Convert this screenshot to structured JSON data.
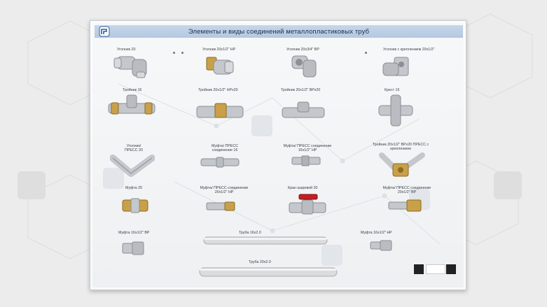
{
  "board": {
    "title": "Элементы и виды соединений металлопластиковых труб"
  },
  "fittings": [
    {
      "label": "Уголник 20"
    },
    {
      "label": "Уголник 20х1/2\" НР"
    },
    {
      "label": "Уголник 20х3/4\" ВР"
    },
    {
      "label": "Уголник с креплением 20х1/2\""
    },
    {
      "label": "Тройник 16"
    },
    {
      "label": "Тройник 20х1/2\" НРх20"
    },
    {
      "label": "Тройник 20х1/2\" ВРх20"
    },
    {
      "label": "Крест 16"
    },
    {
      "label": "Уголник/ ПРЕСС 20"
    },
    {
      "label": "Муфта/ ПРЕСС соединение 16"
    },
    {
      "label": "Муфта/ ПРЕСС соединение 16х1/2\" НР"
    },
    {
      "label": "Тройник 20х1/2\" ВРх20 ПРЕСС с креплением"
    },
    {
      "label": "Муфта 20"
    },
    {
      "label": "Муфта/ ПРЕСС соединение 20х1/2\" НР"
    },
    {
      "label": "Кран шаровой 20"
    },
    {
      "label": "Муфта/ ПРЕСС соединение 20х1/2\" ВР"
    },
    {
      "label": "Муфта 16х1/2\" ВР"
    },
    {
      "label": "Труба 16х2.0"
    },
    {
      "label": "Муфта 16х1/2\" НР"
    },
    {
      "label": "Труба 20х2.0"
    }
  ],
  "colors": {
    "brass": "#c9a04a",
    "nickel": "#c4c7cc",
    "header": "#bfd1e6",
    "valve_handle": "#c81e1e",
    "pipe": "#dcdcdc"
  }
}
